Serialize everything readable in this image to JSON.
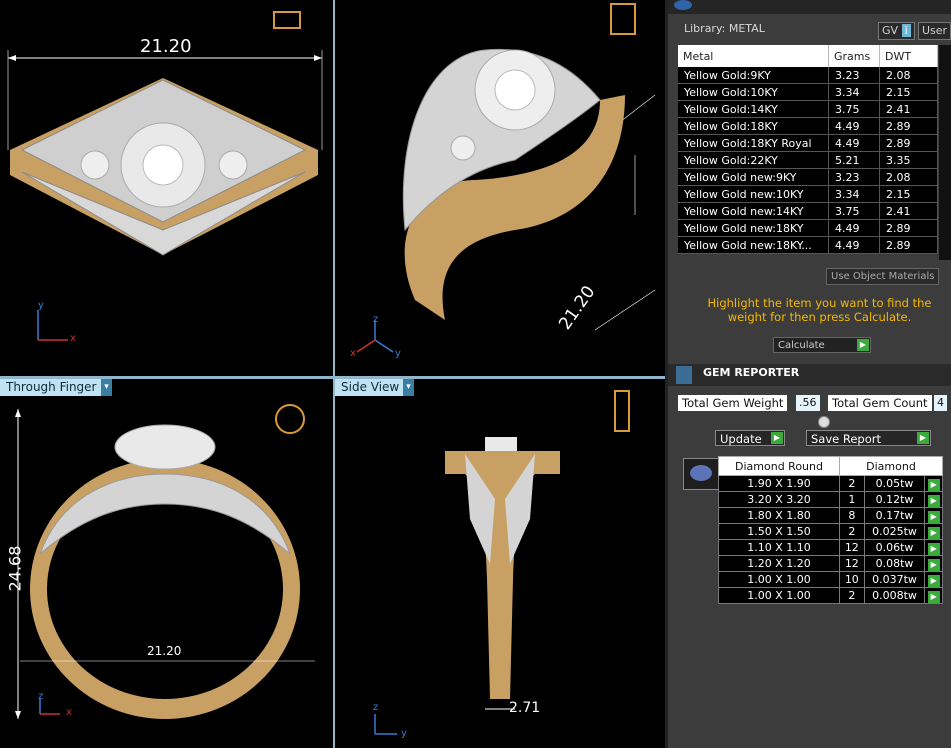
{
  "viewports": {
    "top": {
      "dimension": "21.20",
      "axis_y": "y",
      "axis_x": "x"
    },
    "perspective": {
      "dimension": "21.20",
      "axis_z": "z",
      "axis_x": "x",
      "axis_y": "y"
    },
    "finger": {
      "label": "Through Finger",
      "height_dimension": "24.68",
      "width_dimension": "21.20",
      "axis_z": "z",
      "axis_x": "x"
    },
    "side": {
      "label": "Side View",
      "dimension": "2.71",
      "axis_z": "z",
      "axis_y": "y"
    }
  },
  "library": {
    "label": "Library: METAL",
    "gv_label": "GV",
    "gv_icon": "i",
    "user_label": "User",
    "columns": [
      "Metal",
      "Grams",
      "DWT"
    ],
    "rows": [
      [
        "Yellow Gold:9KY",
        "3.23",
        "2.08"
      ],
      [
        "Yellow Gold:10KY",
        "3.34",
        "2.15"
      ],
      [
        "Yellow Gold:14KY",
        "3.75",
        "2.41"
      ],
      [
        "Yellow Gold:18KY",
        "4.49",
        "2.89"
      ],
      [
        "Yellow Gold:18KY Royal",
        "4.49",
        "2.89"
      ],
      [
        "Yellow Gold:22KY",
        "5.21",
        "3.35"
      ],
      [
        "Yellow Gold new:9KY",
        "3.23",
        "2.08"
      ],
      [
        "Yellow Gold new:10KY",
        "3.34",
        "2.15"
      ],
      [
        "Yellow Gold new:14KY",
        "3.75",
        "2.41"
      ],
      [
        "Yellow Gold new:18KY",
        "4.49",
        "2.89"
      ],
      [
        "Yellow Gold new:18KY...",
        "4.49",
        "2.89"
      ]
    ],
    "use_object_materials": "Use Object Materials",
    "hint": "Highlight the item you want to find the weight for then press Calculate.",
    "calculate_label": "Calculate"
  },
  "gem_reporter": {
    "title": "GEM REPORTER",
    "total_weight_label": "Total Gem Weight",
    "total_weight_value": ".56",
    "total_count_label": "Total Gem Count",
    "total_count_value": "4",
    "update_label": "Update",
    "save_report_label": "Save Report",
    "columns": [
      "Diamond Round",
      "Diamond"
    ],
    "rows": [
      [
        "1.90 X 1.90",
        "2",
        "0.05tw"
      ],
      [
        "3.20 X 3.20",
        "1",
        "0.12tw"
      ],
      [
        "1.80 X 1.80",
        "8",
        "0.17tw"
      ],
      [
        "1.50 X 1.50",
        "2",
        "0.025tw"
      ],
      [
        "1.10 X 1.10",
        "12",
        "0.06tw"
      ],
      [
        "1.20 X 1.20",
        "12",
        "0.08tw"
      ],
      [
        "1.00 X 1.00",
        "10",
        "0.037tw"
      ],
      [
        "1.00 X 1.00",
        "2",
        "0.008tw"
      ]
    ]
  },
  "colors": {
    "gold": "#c8a063",
    "hint": "#f5b800",
    "accent_green": "#3cab3c"
  }
}
